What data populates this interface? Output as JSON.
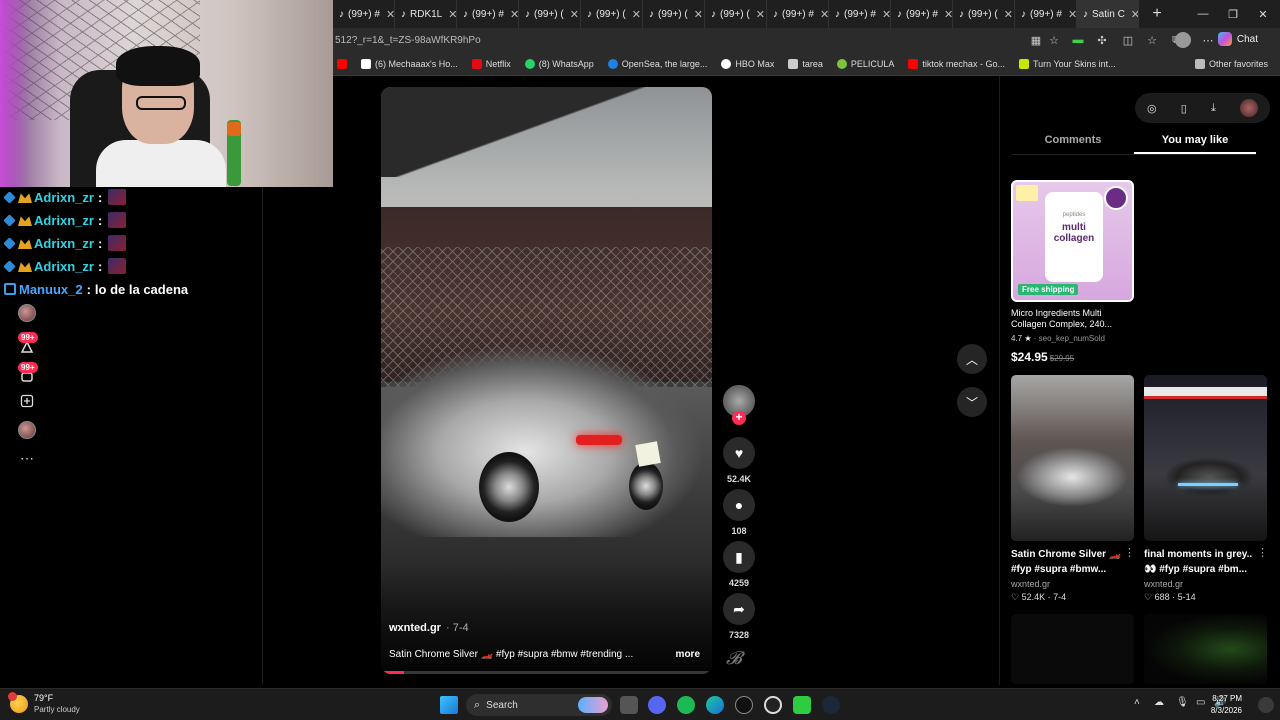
{
  "stream_chat": {
    "lines": [
      {
        "user": "Adrixn_zr",
        "sep": ":"
      },
      {
        "user": "Adrixn_zr",
        "sep": ":"
      },
      {
        "user": "Adrixn_zr",
        "sep": ":"
      },
      {
        "user": "Adrixn_zr",
        "sep": ":"
      },
      {
        "user": "Manuux_2",
        "sep": ":",
        "message": "lo de la cadena"
      }
    ]
  },
  "rail": {
    "badge_activity": "99+",
    "badge_messages": "99+"
  },
  "browser": {
    "tabs": [
      {
        "label": "(99+) #"
      },
      {
        "label": "RDK1L"
      },
      {
        "label": "(99+) #"
      },
      {
        "label": "(99+) ("
      },
      {
        "label": "(99+) ("
      },
      {
        "label": "(99+) ("
      },
      {
        "label": "(99+) ("
      },
      {
        "label": "(99+) #"
      },
      {
        "label": "(99+) #"
      },
      {
        "label": "(99+) #"
      },
      {
        "label": "(99+) ("
      },
      {
        "label": "(99+) #"
      },
      {
        "label": "Satin C"
      }
    ],
    "address": "?_r=1&_t=ZS-98aWfKR9hPo",
    "address_prefix": "512",
    "chat_label": "Chat",
    "bookmarks": [
      {
        "label": "(6) Mechaaax's Ho...",
        "color": "#ffffff"
      },
      {
        "label": "Netflix",
        "color": "#e50914"
      },
      {
        "label": "(8) WhatsApp",
        "color": "#25d366"
      },
      {
        "label": "OpenSea, the large...",
        "color": "#2081e2"
      },
      {
        "label": "HBO Max",
        "color": "#ffffff"
      },
      {
        "label": "tarea",
        "color": "#cccccc"
      },
      {
        "label": "PELICULA",
        "color": "#7cc242"
      },
      {
        "label": "tiktok mechax - Go...",
        "color": "#ff0000"
      },
      {
        "label": "Turn Your Skins int...",
        "color": "#c8e600"
      }
    ],
    "other_favorites": "Other favorites"
  },
  "video": {
    "author": "wxnted.gr",
    "date": "· 7-4",
    "caption": "Satin Chrome Silver 🏎️ #fyp #supra #bmw #trending ...",
    "more": "more",
    "progress": 0.07,
    "likes": "52.4K",
    "comments": "108",
    "saves": "4259",
    "shares": "7328"
  },
  "side_panel": {
    "tabs": [
      "Comments",
      "You may like"
    ],
    "active_tab": "You may like",
    "ad": {
      "title": "Micro Ingredients Multi Collagen Complex, 240...",
      "rating": "4.7",
      "sold": "seo_kep_numSold",
      "price": "$24.95",
      "old_price": "$29.95",
      "badge": "Free shipping",
      "jar_text": "multi collagen",
      "jar_sub": "peptides"
    },
    "videos": [
      {
        "title": "Satin Chrome Silver 🏎️ #fyp #supra #bmw...",
        "user": "wxnted.gr",
        "likes": "52.4K",
        "date": "7-4"
      },
      {
        "title": "final moments in grey.. 👀 #fyp #supra #bm...",
        "user": "wxnted.gr",
        "likes": "688",
        "date": "5-14"
      }
    ]
  },
  "taskbar": {
    "temperature": "79°F",
    "condition": "Partly cloudy",
    "search_placeholder": "Search",
    "time": "8:27 PM",
    "date": "8/3/2026"
  },
  "colors": {
    "accent": "#fe2c55",
    "chat_user": "#2fd3e6",
    "background": "#000000"
  }
}
